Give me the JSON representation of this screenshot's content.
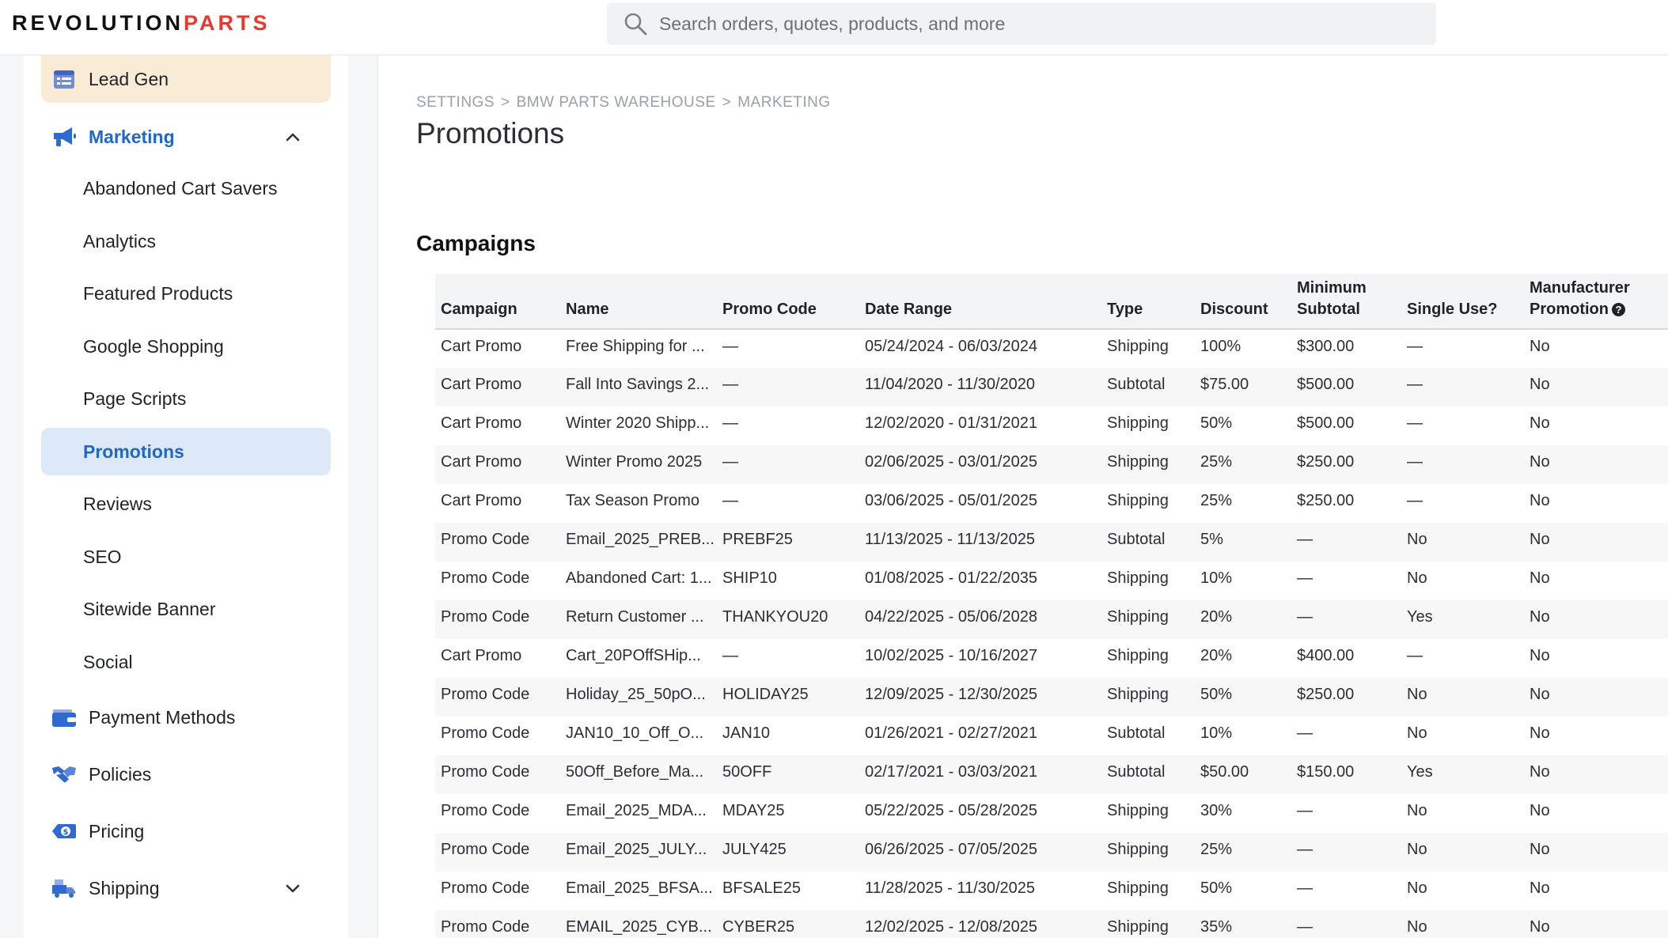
{
  "header": {
    "logo_main": "REVOLUTION",
    "logo_accent": "PARTS",
    "search_placeholder": "Search orders, quotes, products, and more"
  },
  "sidebar": {
    "top_item": "Lead Gen",
    "marketing": "Marketing",
    "sub_items": [
      "Abandoned Cart Savers",
      "Analytics",
      "Featured Products",
      "Google Shopping",
      "Page Scripts",
      "Promotions",
      "Reviews",
      "SEO",
      "Sitewide Banner",
      "Social"
    ],
    "active_item": "Promotions",
    "bottom_items": [
      "Payment Methods",
      "Policies",
      "Pricing",
      "Shipping"
    ]
  },
  "breadcrumb": [
    "SETTINGS",
    "BMW PARTS WAREHOUSE",
    "MARKETING"
  ],
  "page_title": "Promotions",
  "section_title": "Campaigns",
  "table": {
    "columns": [
      "Campaign",
      "Name",
      "Promo Code",
      "Date Range",
      "Type",
      "Discount",
      "Minimum Subtotal",
      "Single Use?",
      "Manufacturer Promotion"
    ],
    "column_lines": {
      "min_subtotal": [
        "Minimum",
        "Subtotal"
      ],
      "manufacturer": [
        "Manufacturer",
        "Promotion"
      ]
    },
    "rows": [
      [
        "Cart Promo",
        "Free Shipping for ...",
        "—",
        "05/24/2024 - 06/03/2024",
        "Shipping",
        "100%",
        "$300.00",
        "—",
        "No"
      ],
      [
        "Cart Promo",
        "Fall Into Savings 2...",
        "—",
        "11/04/2020 - 11/30/2020",
        "Subtotal",
        "$75.00",
        "$500.00",
        "—",
        "No"
      ],
      [
        "Cart Promo",
        "Winter 2020 Shipp...",
        "—",
        "12/02/2020 - 01/31/2021",
        "Shipping",
        "50%",
        "$500.00",
        "—",
        "No"
      ],
      [
        "Cart Promo",
        "Winter Promo 2025",
        "—",
        "02/06/2025 - 03/01/2025",
        "Shipping",
        "25%",
        "$250.00",
        "—",
        "No"
      ],
      [
        "Cart Promo",
        "Tax Season Promo",
        "—",
        "03/06/2025 - 05/01/2025",
        "Shipping",
        "25%",
        "$250.00",
        "—",
        "No"
      ],
      [
        "Promo Code",
        "Email_2025_PREB...",
        "PREBF25",
        "11/13/2025 - 11/13/2025",
        "Subtotal",
        "5%",
        "—",
        "No",
        "No"
      ],
      [
        "Promo Code",
        "Abandoned Cart: 1...",
        "SHIP10",
        "01/08/2025 - 01/22/2035",
        "Shipping",
        "10%",
        "—",
        "No",
        "No"
      ],
      [
        "Promo Code",
        "Return Customer ...",
        "THANKYOU20",
        "04/22/2025 - 05/06/2028",
        "Shipping",
        "20%",
        "—",
        "Yes",
        "No"
      ],
      [
        "Cart Promo",
        "Cart_20POffSHip...",
        "—",
        "10/02/2025 - 10/16/2027",
        "Shipping",
        "20%",
        "$400.00",
        "—",
        "No"
      ],
      [
        "Promo Code",
        "Holiday_25_50pO...",
        "HOLIDAY25",
        "12/09/2025 - 12/30/2025",
        "Shipping",
        "50%",
        "$250.00",
        "No",
        "No"
      ],
      [
        "Promo Code",
        "JAN10_10_Off_O...",
        "JAN10",
        "01/26/2021 - 02/27/2021",
        "Subtotal",
        "10%",
        "—",
        "No",
        "No"
      ],
      [
        "Promo Code",
        "50Off_Before_Ma...",
        "50OFF",
        "02/17/2021 - 03/03/2021",
        "Subtotal",
        "$50.00",
        "$150.00",
        "Yes",
        "No"
      ],
      [
        "Promo Code",
        "Email_2025_MDA...",
        "MDAY25",
        "05/22/2025 - 05/28/2025",
        "Shipping",
        "30%",
        "—",
        "No",
        "No"
      ],
      [
        "Promo Code",
        "Email_2025_JULY...",
        "JULY425",
        "06/26/2025 - 07/05/2025",
        "Shipping",
        "25%",
        "—",
        "No",
        "No"
      ],
      [
        "Promo Code",
        "Email_2025_BFSA...",
        "BFSALE25",
        "11/28/2025 - 11/30/2025",
        "Shipping",
        "50%",
        "—",
        "No",
        "No"
      ],
      [
        "Promo Code",
        "EMAIL_2025_CYB...",
        "CYBER25",
        "12/02/2025 - 12/08/2025",
        "Shipping",
        "35%",
        "—",
        "No",
        "No"
      ]
    ]
  },
  "colors": {
    "accent_blue": "#1f67c8",
    "logo_red": "#e8392e",
    "active_bg": "#dde9f8",
    "top_item_bg": "#f9ebd6"
  }
}
